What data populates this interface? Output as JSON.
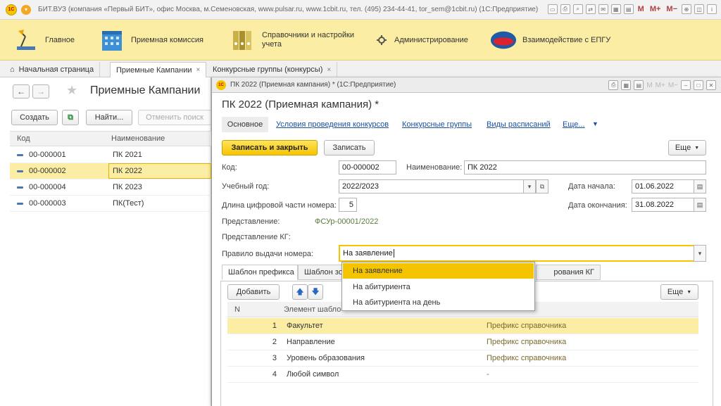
{
  "titlebar": {
    "logo": "1С",
    "title": "БИТ.ВУЗ (компания «Первый БИТ», офис Москва, м.Семеновская, www.pulsar.ru, www.1cbit.ru, тел. (495) 234-44-41, tor_sem@1cbit.ru)  (1С:Предприятие)",
    "m": "M",
    "mplus": "M+",
    "mminus": "M−"
  },
  "sections": [
    {
      "label": "Главное",
      "icon": "desk-lamp-icon"
    },
    {
      "label": "Приемная комиссия",
      "icon": "building-icon"
    },
    {
      "label": "Справочники и настройки учета",
      "icon": "binders-icon"
    },
    {
      "label": "Администрирование",
      "icon": "gear-icon"
    },
    {
      "label": "Взаимодействие с ЕПГУ",
      "icon": "gosuslugi-icon",
      "logo_text": "ГОС УСЛУГИ"
    }
  ],
  "open_tabs": [
    {
      "label": "Начальная страница"
    },
    {
      "label": "Приемные Кампании",
      "close": "×"
    },
    {
      "label": "Конкурсные группы (конкурсы)",
      "close": "×"
    }
  ],
  "list": {
    "title": "Приемные Кампании",
    "back": "←",
    "forward": "→",
    "star": "★",
    "create": "Создать",
    "find": "Найти...",
    "cancel_search": "Отменить поиск",
    "columns": [
      "Код",
      "Наименование"
    ],
    "rows": [
      {
        "code": "00-000001",
        "name": "ПК 2021"
      },
      {
        "code": "00-000002",
        "name": "ПК 2022"
      },
      {
        "code": "00-000004",
        "name": "ПК 2023"
      },
      {
        "code": "00-000003",
        "name": "ПК(Тест)"
      }
    ]
  },
  "form": {
    "window_title": "ПК 2022 (Приемная кампания) * (1С:Предприятие)",
    "heading": "ПК 2022 (Приемная кампания) *",
    "nav": [
      "Основное",
      "Условия проведения конкурсов",
      "Конкурсные группы",
      "Виды расписаний",
      "Еще..."
    ],
    "save_close": "Записать и закрыть",
    "save": "Записать",
    "more": "Еще",
    "code_label": "Код:",
    "code": "00-000002",
    "name_label": "Наименование:",
    "name": "ПК 2022",
    "year_label": "Учебный год:",
    "year": "2022/2023",
    "start_label": "Дата начала:",
    "start": "01.06.2022",
    "end_label": "Дата окончания:",
    "end": "31.08.2022",
    "digits_label": "Длина цифровой части номера:",
    "digits": "5",
    "repr_label": "Представление:",
    "repr": "ФСУр-00001/2022",
    "repr_kg_label": "Представление КГ:",
    "rule_label": "Правило выдачи номера:",
    "rule": "На заявление",
    "tabs": [
      "Шаблон префикса",
      "Шаблон зо",
      "рования КГ"
    ],
    "add": "Добавить",
    "grid_columns": [
      "N",
      "Элемент шабло"
    ],
    "grid_rows": [
      {
        "n": "1",
        "element": "Факультет",
        "type": "Префикс справочника"
      },
      {
        "n": "2",
        "element": "Направление",
        "type": "Префикс справочника"
      },
      {
        "n": "3",
        "element": "Уровень образования",
        "type": "Префикс справочника"
      },
      {
        "n": "4",
        "element": "Любой символ",
        "type": "-"
      }
    ],
    "dropdown_options": [
      "На заявление",
      "На абитуриента",
      "На абитуриента на день"
    ]
  }
}
